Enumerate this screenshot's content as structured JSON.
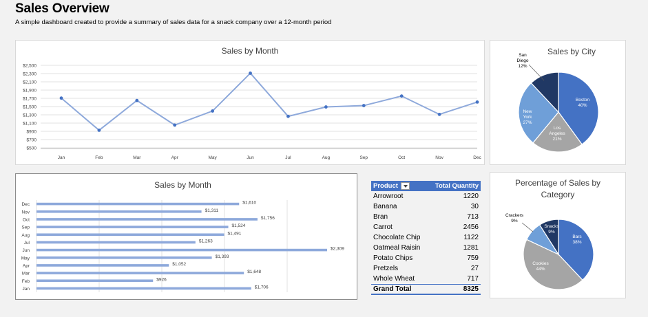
{
  "header": {
    "title": "Sales Overview",
    "subtitle": "A simple dashboard created to provide a summary of sales data for a snack company over a 12-month period"
  },
  "line_chart": {
    "title": "Sales by Month"
  },
  "bar_chart": {
    "title": "Sales by Month"
  },
  "city_chart": {
    "title": "Sales by City"
  },
  "category_chart": {
    "title": "Percentage of Sales by Category"
  },
  "pivot": {
    "header_product": "Product",
    "header_qty": "Total Quantity",
    "rows": [
      {
        "product": "Arrowroot",
        "qty": "1220"
      },
      {
        "product": "Banana",
        "qty": "30"
      },
      {
        "product": "Bran",
        "qty": "713"
      },
      {
        "product": "Carrot",
        "qty": "2456"
      },
      {
        "product": "Chocolate Chip",
        "qty": "1122"
      },
      {
        "product": "Oatmeal Raisin",
        "qty": "1281"
      },
      {
        "product": "Potato Chips",
        "qty": "759"
      },
      {
        "product": "Pretzels",
        "qty": "27"
      },
      {
        "product": "Whole Wheat",
        "qty": "717"
      }
    ],
    "total_label": "Grand Total",
    "total_qty": "8325"
  },
  "colors": {
    "line": "#8ea9db",
    "marker": "#4472c4",
    "bar": "#8ea9db",
    "pie_dark": "#203864",
    "pie_blue": "#4472c4",
    "pie_mid": "#6f9fd8",
    "pie_gray": "#a5a5a5"
  },
  "chart_data": [
    {
      "type": "line",
      "title": "Sales by Month",
      "categories": [
        "Jan",
        "Feb",
        "Mar",
        "Apr",
        "May",
        "Jun",
        "Jul",
        "Aug",
        "Sep",
        "Oct",
        "Nov",
        "Dec"
      ],
      "values": [
        1706,
        926,
        1648,
        1052,
        1393,
        2309,
        1263,
        1491,
        1524,
        1756,
        1311,
        1610
      ],
      "yticks": [
        "$500",
        "$700",
        "$900",
        "$1,100",
        "$1,300",
        "$1,500",
        "$1,700",
        "$1,900",
        "$2,100",
        "$2,300",
        "$2,500"
      ],
      "ylim": [
        500,
        2500
      ],
      "grid": true
    },
    {
      "type": "bar",
      "orientation": "horizontal",
      "title": "Sales by Month",
      "categories": [
        "Dec",
        "Nov",
        "Oct",
        "Sep",
        "Aug",
        "Jul",
        "Jun",
        "May",
        "Apr",
        "Mar",
        "Feb",
        "Jan"
      ],
      "values": [
        1610,
        1311,
        1756,
        1524,
        1491,
        1263,
        2309,
        1393,
        1052,
        1648,
        926,
        1706
      ],
      "labels": [
        "$1,610",
        "$1,311",
        "$1,756",
        "$1,524",
        "$1,491",
        "$1,263",
        "$2,309",
        "$1,393",
        "$1,052",
        "$1,648",
        "$926",
        "$1,706"
      ],
      "grid": true
    },
    {
      "type": "pie",
      "title": "Sales by City",
      "slices": [
        {
          "label": [
            "Boston",
            "40%"
          ],
          "value": 40
        },
        {
          "label": [
            "Los",
            "Angeles",
            "21%"
          ],
          "value": 21
        },
        {
          "label": [
            "New",
            "York",
            "27%"
          ],
          "value": 27
        },
        {
          "label": [
            "San",
            "Diego",
            "12%"
          ],
          "value": 12
        }
      ]
    },
    {
      "type": "pie",
      "title": "Percentage of Sales by Category",
      "slices": [
        {
          "label": [
            "Bars",
            "38%"
          ],
          "value": 38
        },
        {
          "label": [
            "Cookies",
            "44%"
          ],
          "value": 44
        },
        {
          "label": [
            "Crackers",
            "9%"
          ],
          "value": 9
        },
        {
          "label": [
            "Snacks",
            "9%"
          ],
          "value": 9
        }
      ]
    }
  ]
}
